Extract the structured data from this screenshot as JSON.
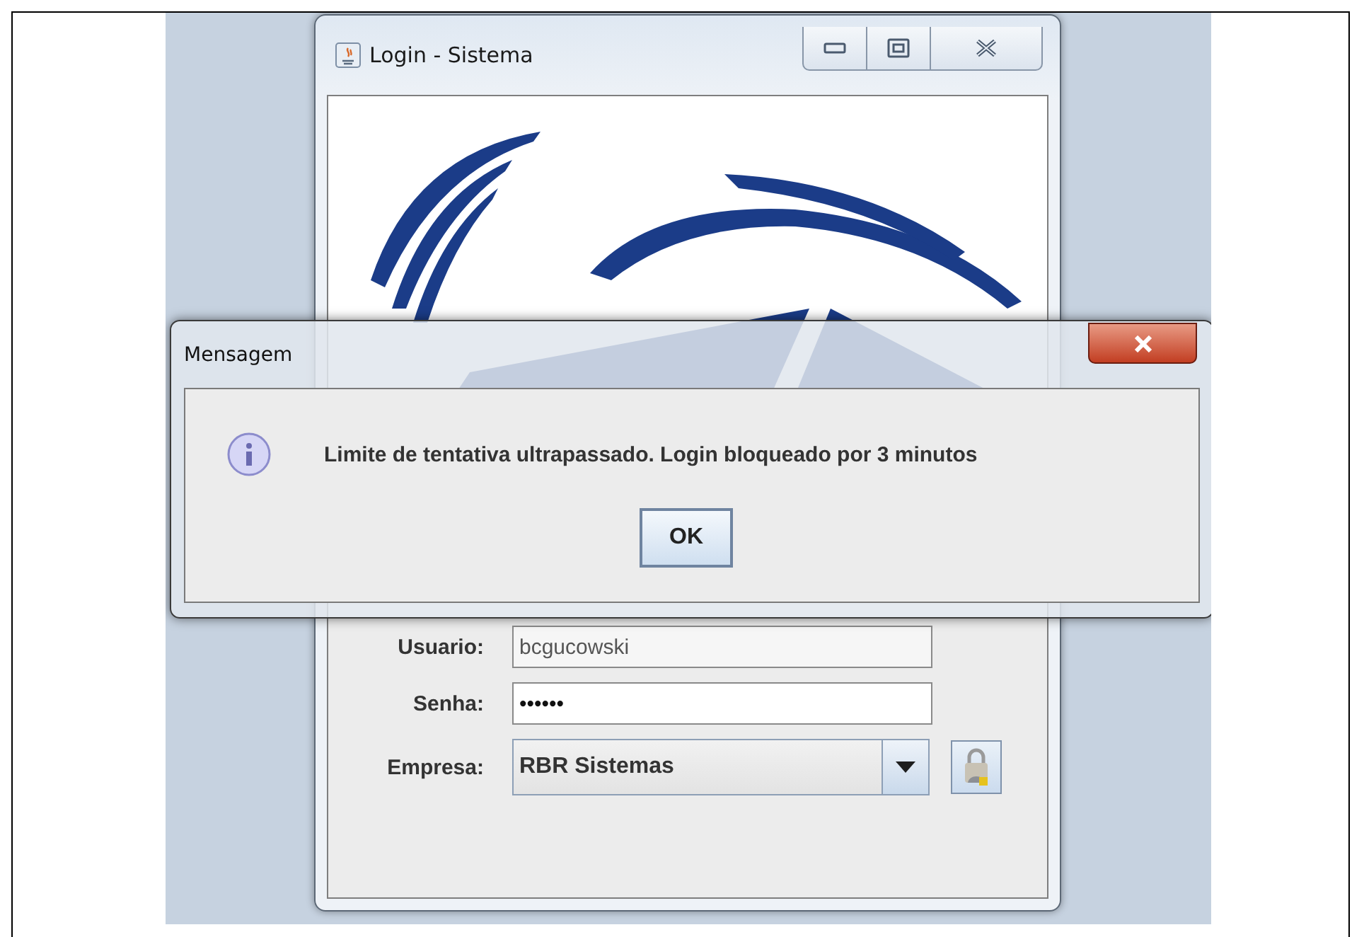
{
  "login_window": {
    "title": "Login - Sistema",
    "fields": [
      {
        "label": "Usuario:",
        "value": "bcgucowski",
        "disabled": true
      },
      {
        "label": "Senha:",
        "value": "••••••",
        "disabled": false
      }
    ],
    "company": {
      "label": "Empresa:",
      "value": "RBR Sistemas"
    }
  },
  "dialog": {
    "title": "Mensagem",
    "message": "Limite de tentativa ultrapassado. Login bloqueado por 3 minutos",
    "buttons": [
      "OK"
    ]
  }
}
